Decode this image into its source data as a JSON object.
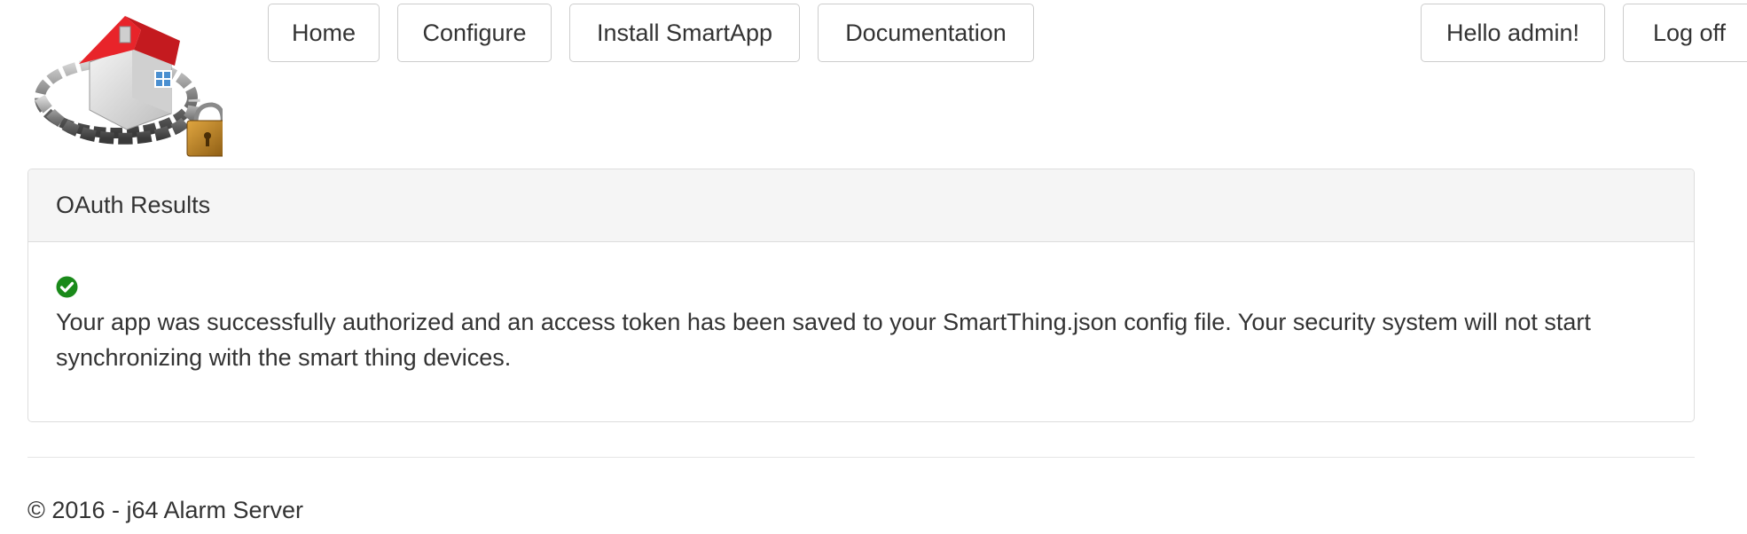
{
  "nav": {
    "home": "Home",
    "configure": "Configure",
    "install": "Install SmartApp",
    "documentation": "Documentation",
    "hello": "Hello admin!",
    "logoff": "Log off"
  },
  "panel": {
    "heading": "OAuth Results",
    "message": "Your app was successfully authorized and an access token has been saved to your SmartThing.json config file. Your security system will not start synchronizing with the smart thing devices.",
    "status_icon": "check-circle-icon",
    "status_color": "#1a8a1a"
  },
  "footer": {
    "copyright": "© 2016 - j64 Alarm Server"
  },
  "colors": {
    "roof": "#e8242a",
    "panel_heading_bg": "#f5f5f5",
    "border": "#cccccc"
  },
  "logo": {
    "icon": "house-chain-padlock-icon"
  }
}
